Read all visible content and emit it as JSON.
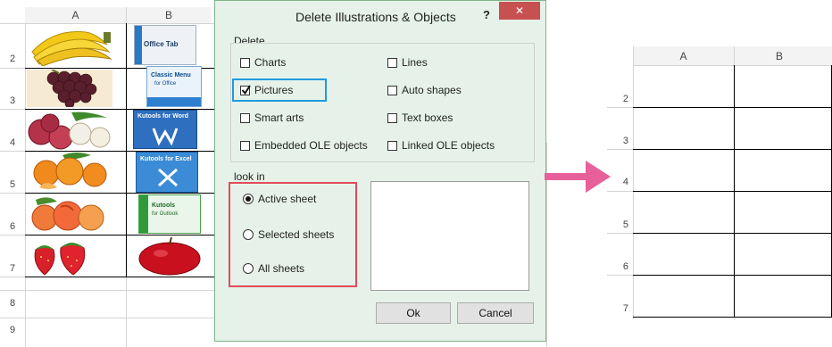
{
  "left_sheet": {
    "columns": [
      "A",
      "B"
    ],
    "rows": [
      "2",
      "3",
      "4",
      "5",
      "6",
      "7",
      "8",
      "9"
    ],
    "images": {
      "a": [
        "banana-image",
        "grapes-image",
        "lychee-image",
        "tangerine-image",
        "peach-image",
        "strawberry-image"
      ],
      "b": [
        "office-tab-box-image",
        "classic-menu-box-image",
        "kutools-word-box-image",
        "kutools-excel-box-image",
        "kutools-outlook-box-image",
        "apple-image"
      ]
    },
    "box_texts": {
      "office_tab": "Office Tab",
      "classic_menu": "Classic Menu",
      "classic_menu_sub": "for Office",
      "kutools_word": "Kutools for Word",
      "kutools_excel": "Kutools for Excel",
      "kutools_outlook": "Kutools",
      "kutools_outlook_sub": "for Outlook"
    }
  },
  "dialog": {
    "title": "Delete Illustrations & Objects",
    "help": "?",
    "close": "✕",
    "delete_group_label": "Delete",
    "delete_options": {
      "charts": {
        "label": "Charts",
        "checked": false
      },
      "lines": {
        "label": "Lines",
        "checked": false
      },
      "pictures": {
        "label": "Pictures",
        "checked": true
      },
      "auto_shapes": {
        "label": "Auto shapes",
        "checked": false
      },
      "smart_arts": {
        "label": "Smart arts",
        "checked": false
      },
      "text_boxes": {
        "label": "Text boxes",
        "checked": false
      },
      "embedded_ole": {
        "label": "Embedded OLE objects",
        "checked": false
      },
      "linked_ole": {
        "label": "Linked OLE objects",
        "checked": false
      }
    },
    "look_in_label": "look in",
    "look_in_options": {
      "active_sheet": {
        "label": "Active sheet",
        "selected": true
      },
      "selected_sheets": {
        "label": "Selected sheets",
        "selected": false
      },
      "all_sheets": {
        "label": "All sheets",
        "selected": false
      }
    },
    "ok_label": "Ok",
    "cancel_label": "Cancel"
  },
  "arrow_color": "#e8609a",
  "highlight_colors": {
    "pictures": "#1e9be0",
    "look_in": "#e24b5a"
  },
  "right_sheet": {
    "columns": [
      "A",
      "B"
    ],
    "rows": [
      "2",
      "3",
      "4",
      "5",
      "6",
      "7"
    ]
  }
}
